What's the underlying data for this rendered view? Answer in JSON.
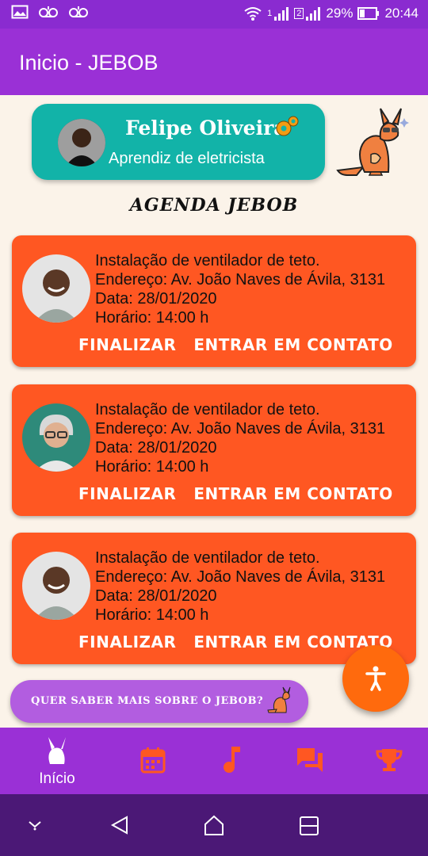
{
  "status_bar": {
    "battery": "29%",
    "time": "20:44",
    "sim1": "1",
    "sim2": "2"
  },
  "app_bar": {
    "title": "Inicio - JEBOB"
  },
  "profile": {
    "name": "Felipe Oliveira",
    "role": "Aprendiz de eletricista"
  },
  "section_title": "AGENDA JEBOB",
  "appointments": [
    {
      "service": "Instalação de ventilador de teto.",
      "address": "Endereço: Av. João Naves de Ávila, 3131",
      "date": "Data: 28/01/2020",
      "time": "Horário: 14:00 h",
      "finish_label": "FINALIZAR",
      "contact_label": "ENTRAR EM CONTATO"
    },
    {
      "service": "Instalação de ventilador de teto.",
      "address": "Endereço: Av. João Naves de Ávila, 3131",
      "date": "Data: 28/01/2020",
      "time": "Horário: 14:00 h",
      "finish_label": "FINALIZAR",
      "contact_label": "ENTRAR EM CONTATO"
    },
    {
      "service": "Instalação de ventilador de teto.",
      "address": "Endereço: Av. João Naves de Ávila, 3131",
      "date": "Data: 28/01/2020",
      "time": "Horário: 14:00 h",
      "finish_label": "FINALIZAR",
      "contact_label": "ENTRAR EM CONTATO"
    }
  ],
  "more_button": {
    "label": "QUER SABER MAIS SOBRE O JEBOB?"
  },
  "bottom_nav": {
    "items": [
      {
        "label": "Início",
        "icon": "kangaroo-icon",
        "active": true
      },
      {
        "label": "",
        "icon": "calendar-icon"
      },
      {
        "label": "",
        "icon": "music-note-icon"
      },
      {
        "label": "",
        "icon": "chat-icon"
      },
      {
        "label": "",
        "icon": "trophy-icon"
      }
    ]
  },
  "colors": {
    "primary": "#9a30d6",
    "card": "#ff5722",
    "profile": "#12b3a8",
    "fab": "#ff6a0d",
    "background": "#fbf3e9",
    "nav_icon": "#ff5722"
  }
}
